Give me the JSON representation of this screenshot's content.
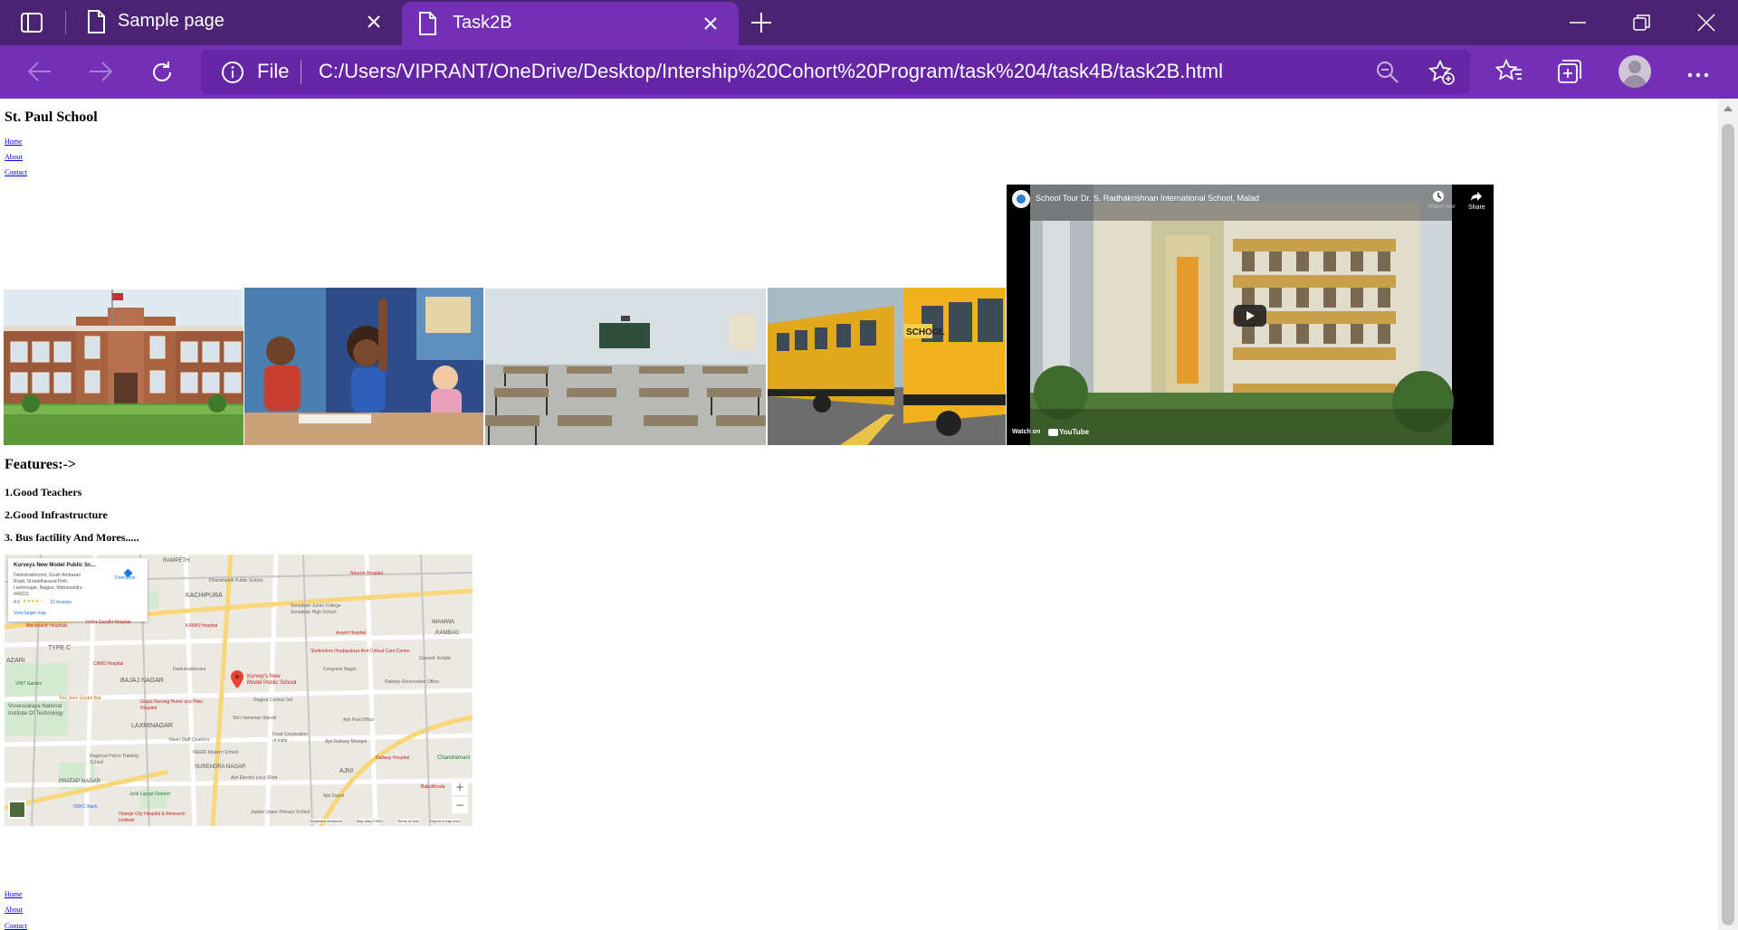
{
  "browser": {
    "tabs": [
      {
        "title": "Sample page"
      },
      {
        "title": "Task2B"
      }
    ],
    "address": {
      "scheme_label": "File",
      "url": "C:/Users/VIPRANT/OneDrive/Desktop/Intership%20Cohort%20Program/task%204/task4B/task2B.html"
    },
    "colors": {
      "frame": "#4a2472",
      "active": "#7330b6"
    }
  },
  "page": {
    "site_title": "St. Paul School",
    "top_nav": [
      "Home",
      "About",
      "Contact"
    ],
    "video": {
      "title": "School Tour Dr. S. Radhakrishnan International School, Malad",
      "watch_later": "Watch later",
      "share": "Share",
      "watch_on": "Watch on",
      "youtube": "YouTube"
    },
    "features_heading": "Features:->",
    "features": [
      "1.Good Teachers",
      "2.Good Infrastructure",
      "3. Bus factility And Mores....."
    ],
    "map": {
      "place_name": "Kurveys New Model Public Sc...",
      "address_lines": [
        "Deekshabhoomi, South Ambazari",
        "Road, Shraddhanand Peth,",
        "Laxminagar, Nagpur, Maharashtra",
        "440022"
      ],
      "rating": "4.0",
      "reviews": "12 reviews",
      "directions": "Directions",
      "larger_map": "View larger map",
      "pin_label_1": "Kurvey's New",
      "pin_label_2": "Model Public School",
      "labels": [
        "RAMPETH",
        "KACHIPURA",
        "Dharampeth Public School",
        "Neuron Hospital",
        "Somalwar Junior College",
        "Somalwar High School",
        "KRIMS Hospital",
        "Indira Gandhi Hospital",
        "Wockhardt Hospitals",
        "Avanti Hospital",
        "Shrikrishna Hrudayalaya And Critical Care Center",
        "Ganesh Temple",
        "Deekshabhoomi",
        "CIIMS Hospital",
        "BAJAJ NAGAR",
        "VNIT Garden",
        "Two Joes Gastro Bar",
        "Visvesvaraya National Institute Of Technology",
        "Gupta Nursing Home and Piles Hospital",
        "Nagpur Central Jail",
        "Shri Hanuman Mandir",
        "Ajni Post Office",
        "LAXMINAGAR",
        "Neeri Staff Quarters",
        "NEERI Modern School",
        "Food Corporation of India",
        "Ajni Railway Mosque",
        "Regional Police Training School",
        "SURENDRA NAGAR",
        "Ajni Electric Loco Shed",
        "PRATAP NAGAR",
        "AJNI",
        "Railway Hospital",
        "Chandramani",
        "Ajni Depot",
        "Babulkheda",
        "Orange City Hospital & Research Institute",
        "Jupiter Upper Primary School",
        "HDFC Bank",
        "Jyoti Layout Ground",
        "Congress Nagar",
        "Railway Reservation Office",
        "AZARI",
        "TYPE C",
        "IMAMWA",
        "RAMBAG"
      ],
      "footer": [
        "Keyboard shortcuts",
        "Map data ©2022",
        "Terms of Use",
        "Report a map error"
      ]
    },
    "bottom_nav": [
      "Home",
      "About",
      "Contact"
    ]
  }
}
